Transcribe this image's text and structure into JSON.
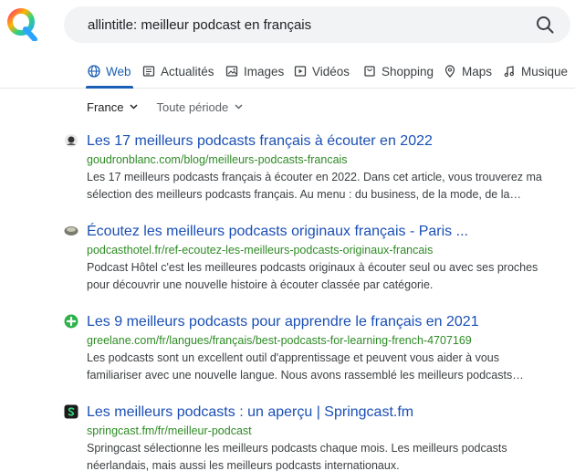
{
  "search": {
    "query": "allintitle: meilleur podcast en français"
  },
  "tabs": [
    {
      "label": "Web",
      "icon": "globe-icon"
    },
    {
      "label": "Actualités",
      "icon": "newspaper-icon"
    },
    {
      "label": "Images",
      "icon": "image-icon"
    },
    {
      "label": "Vidéos",
      "icon": "play-icon"
    },
    {
      "label": "Shopping",
      "icon": "shopping-bag-icon"
    },
    {
      "label": "Maps",
      "icon": "map-pin-icon"
    },
    {
      "label": "Musique",
      "icon": "music-note-icon"
    }
  ],
  "filters": {
    "region": "France",
    "period": "Toute période"
  },
  "results": [
    {
      "title": "Les 17 meilleurs podcasts français à écouter en 2022",
      "url": "goudronblanc.com/blog/meilleurs-podcasts-francais",
      "snippet_line1": "Les 17 meilleurs podcasts français à écouter en 2022. Dans cet article, vous trouverez ma",
      "snippet_line2": "sélection des meilleurs podcasts français. Au menu : du business, de la mode, de la…"
    },
    {
      "title": "Écoutez les meilleurs podcasts originaux français - Paris ...",
      "url": "podcasthotel.fr/ref-ecoutez-les-meilleurs-podcasts-originaux-francais",
      "snippet_line1": "Podcast Hôtel c'est les meilleures podcasts originaux à écouter seul ou avec ses proches",
      "snippet_line2": "pour découvrir une nouvelle histoire à écouter classée par catégorie."
    },
    {
      "title": "Les 9 meilleurs podcasts pour apprendre le français en 2021",
      "url": "greelane.com/fr/langues/français/best-podcasts-for-learning-french-4707169",
      "snippet_line1": "Les podcasts sont un excellent outil d'apprentissage et peuvent vous aider à vous",
      "snippet_line2": "familiariser avec une nouvelle langue. Nous avons rassemblé les meilleurs podcasts…"
    },
    {
      "title": "Les meilleurs podcasts : un aperçu | Springcast.fm",
      "url": "springcast.fm/fr/meilleur-podcast",
      "snippet_line1": "Springcast sélectionne les meilleurs podcasts chaque mois. Les meilleurs podcasts",
      "snippet_line2": "néerlandais, mais aussi les meilleurs podcasts internationaux."
    }
  ],
  "colors": {
    "accent": "#1a5fb4",
    "title_link": "#1a4fb5",
    "url_green": "#2e8b25",
    "snippet": "#3c4043",
    "search_bg": "#f1f3f4"
  }
}
